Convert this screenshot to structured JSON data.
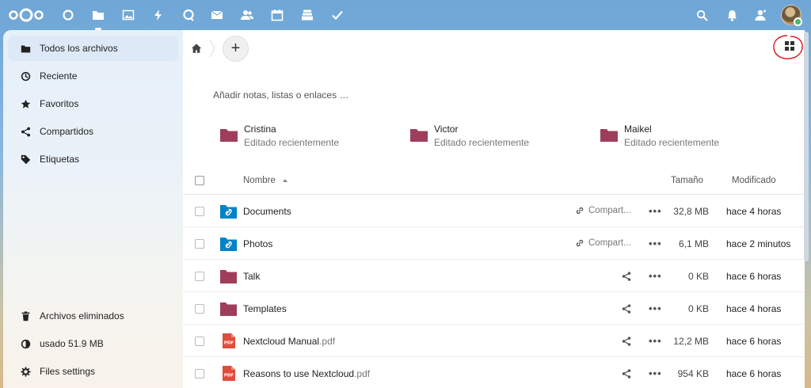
{
  "topbar": {
    "apps": [
      "dashboard-icon",
      "files-icon",
      "photos-icon",
      "activity-icon",
      "talk-icon",
      "mail-icon",
      "contacts-icon",
      "calendar-icon",
      "deck-icon",
      "tasks-icon"
    ],
    "right": [
      "search-icon",
      "notifications-icon",
      "contacts-menu-icon",
      "user-avatar"
    ]
  },
  "sidebar": {
    "items": [
      {
        "label": "Todos los archivos",
        "icon": "folder-icon"
      },
      {
        "label": "Reciente",
        "icon": "clock-icon"
      },
      {
        "label": "Favoritos",
        "icon": "star-icon"
      },
      {
        "label": "Compartidos",
        "icon": "share-icon"
      },
      {
        "label": "Etiquetas",
        "icon": "tag-icon"
      }
    ],
    "bottom": [
      {
        "label": "Archivos eliminados",
        "icon": "trash-icon"
      },
      {
        "label": "usado 51.9 MB",
        "icon": "quota-icon"
      },
      {
        "label": "Files settings",
        "icon": "gear-icon"
      }
    ]
  },
  "main": {
    "add_label": "+",
    "notes_placeholder": "Añadir notas, listas o enlaces …",
    "recent": [
      {
        "name": "Cristina",
        "sub": "Editado recientemente"
      },
      {
        "name": "Victor",
        "sub": "Editado recientemente"
      },
      {
        "name": "Maikel",
        "sub": "Editado recientemente"
      }
    ],
    "columns": {
      "name": "Nombre",
      "size": "Tamaño",
      "modified": "Modificado"
    },
    "files": [
      {
        "name": "Documents",
        "ext": "",
        "type": "shared-folder",
        "share": "Compart...",
        "size": "32,8 MB",
        "modified": "hace 4 horas"
      },
      {
        "name": "Photos",
        "ext": "",
        "type": "shared-folder",
        "share": "Compart...",
        "size": "6,1 MB",
        "modified": "hace 2 minutos"
      },
      {
        "name": "Talk",
        "ext": "",
        "type": "folder",
        "share": "",
        "size": "0 KB",
        "modified": "hace 6 horas"
      },
      {
        "name": "Templates",
        "ext": "",
        "type": "folder",
        "share": "",
        "size": "0 KB",
        "modified": "hace 4 horas"
      },
      {
        "name": "Nextcloud Manual",
        "ext": ".pdf",
        "type": "pdf",
        "share": "",
        "size": "12,2 MB",
        "modified": "hace 6 horas"
      },
      {
        "name": "Reasons to use Nextcloud",
        "ext": ".pdf",
        "type": "pdf",
        "share": "",
        "size": "954 KB",
        "modified": "hace 6 horas"
      }
    ],
    "more_label": "•••"
  },
  "colors": {
    "accent": "#0082c9",
    "folder": "#9e3e5a",
    "pdf": "#e04c3c",
    "annotation": "#e0141e"
  }
}
